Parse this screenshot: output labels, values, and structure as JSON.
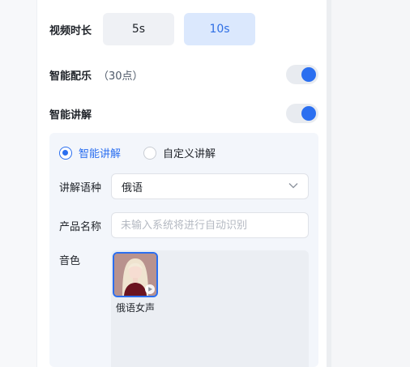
{
  "settings": {
    "video_duration": {
      "label": "视频时长",
      "options": [
        "5s",
        "10s"
      ],
      "selected": "10s"
    },
    "smart_music": {
      "label": "智能配乐",
      "note": "（30点）",
      "enabled": true
    },
    "smart_narration": {
      "label": "智能讲解",
      "enabled": true
    }
  },
  "narration": {
    "mode_options": [
      {
        "label": "智能讲解",
        "selected": true
      },
      {
        "label": "自定义讲解",
        "selected": false
      }
    ],
    "language": {
      "label": "讲解语种",
      "value": "俄语"
    },
    "product_name": {
      "label": "产品名称",
      "placeholder": "未输入系统将进行自动识别",
      "value": ""
    },
    "voice": {
      "label": "音色",
      "items": [
        {
          "name": "俄语女声",
          "selected": true
        }
      ]
    }
  },
  "colors": {
    "accent": "#2b6ff0",
    "accent_light": "#dbe8fd"
  }
}
